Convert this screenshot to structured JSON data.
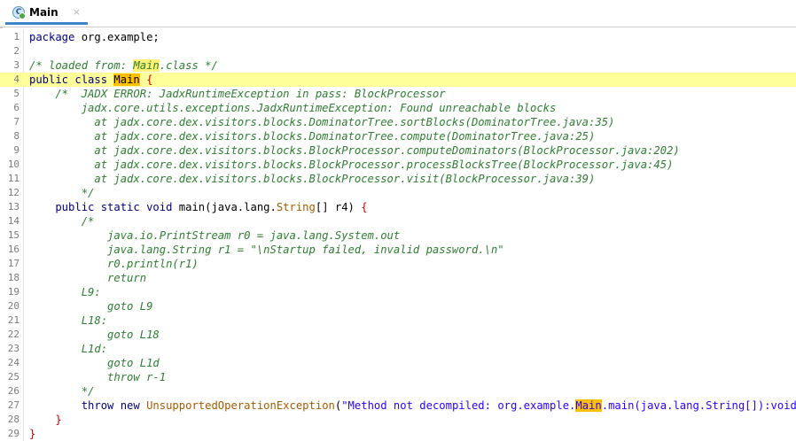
{
  "tab": {
    "label": "Main",
    "icon": "class-file-icon",
    "close_glyph": "×"
  },
  "highlight_color": "#ffff99",
  "lines": [
    {
      "n": "1",
      "t": [
        {
          "k": "kw",
          "v": "package"
        },
        {
          "k": "",
          "v": " org.example;"
        }
      ]
    },
    {
      "n": "2",
      "t": []
    },
    {
      "n": "3",
      "t": [
        {
          "k": "cm",
          "v": "/* loaded from: "
        },
        {
          "k": "cm mark soft",
          "v": "Main"
        },
        {
          "k": "cm",
          "v": ".class */"
        }
      ]
    },
    {
      "n": "4",
      "hl": true,
      "t": [
        {
          "k": "kw",
          "v": "public class "
        },
        {
          "k": "mark",
          "v": "Main"
        },
        {
          "k": "red",
          "v": " {"
        }
      ]
    },
    {
      "n": "5",
      "t": [
        {
          "k": "cm",
          "v": "    /*  JADX ERROR: JadxRuntimeException in pass: BlockProcessor"
        }
      ]
    },
    {
      "n": "6",
      "t": [
        {
          "k": "cm",
          "v": "        jadx.core.utils.exceptions.JadxRuntimeException: Found unreachable blocks"
        }
      ]
    },
    {
      "n": "7",
      "t": [
        {
          "k": "cm",
          "v": "          at jadx.core.dex.visitors.blocks.DominatorTree.sortBlocks(DominatorTree.java:35)"
        }
      ]
    },
    {
      "n": "8",
      "t": [
        {
          "k": "cm",
          "v": "          at jadx.core.dex.visitors.blocks.DominatorTree.compute(DominatorTree.java:25)"
        }
      ]
    },
    {
      "n": "9",
      "t": [
        {
          "k": "cm",
          "v": "          at jadx.core.dex.visitors.blocks.BlockProcessor.computeDominators(BlockProcessor.java:202)"
        }
      ]
    },
    {
      "n": "10",
      "t": [
        {
          "k": "cm",
          "v": "          at jadx.core.dex.visitors.blocks.BlockProcessor.processBlocksTree(BlockProcessor.java:45)"
        }
      ]
    },
    {
      "n": "11",
      "t": [
        {
          "k": "cm",
          "v": "          at jadx.core.dex.visitors.blocks.BlockProcessor.visit(BlockProcessor.java:39)"
        }
      ]
    },
    {
      "n": "12",
      "t": [
        {
          "k": "cm",
          "v": "        */"
        }
      ]
    },
    {
      "n": "13",
      "t": [
        {
          "k": "kw",
          "v": "    public static void "
        },
        {
          "k": "",
          "v": "main(java.lang."
        },
        {
          "k": "ty",
          "v": "String"
        },
        {
          "k": "",
          "v": "[] r4) "
        },
        {
          "k": "red",
          "v": "{"
        }
      ]
    },
    {
      "n": "14",
      "t": [
        {
          "k": "cm",
          "v": "        /*"
        }
      ]
    },
    {
      "n": "15",
      "t": [
        {
          "k": "cm",
          "v": "            java.io.PrintStream r0 = java.lang.System.out"
        }
      ]
    },
    {
      "n": "16",
      "t": [
        {
          "k": "cm",
          "v": "            java.lang.String r1 = \"\\nStartup failed, invalid password.\\n\""
        }
      ]
    },
    {
      "n": "17",
      "t": [
        {
          "k": "cm",
          "v": "            r0.println(r1)"
        }
      ]
    },
    {
      "n": "18",
      "t": [
        {
          "k": "cm",
          "v": "            return"
        }
      ]
    },
    {
      "n": "19",
      "t": [
        {
          "k": "cm",
          "v": "        L9:"
        }
      ]
    },
    {
      "n": "20",
      "t": [
        {
          "k": "cm",
          "v": "            goto L9"
        }
      ]
    },
    {
      "n": "21",
      "t": [
        {
          "k": "cm",
          "v": "        L18:"
        }
      ]
    },
    {
      "n": "22",
      "t": [
        {
          "k": "cm",
          "v": "            goto L18"
        }
      ]
    },
    {
      "n": "23",
      "t": [
        {
          "k": "cm",
          "v": "        L1d:"
        }
      ]
    },
    {
      "n": "24",
      "t": [
        {
          "k": "cm",
          "v": "            goto L1d"
        }
      ]
    },
    {
      "n": "25",
      "t": [
        {
          "k": "cm",
          "v": "            throw r-1"
        }
      ]
    },
    {
      "n": "26",
      "t": [
        {
          "k": "cm",
          "v": "        */"
        }
      ]
    },
    {
      "n": "27",
      "t": [
        {
          "k": "kw",
          "v": "        throw new "
        },
        {
          "k": "ty",
          "v": "UnsupportedOperationException"
        },
        {
          "k": "",
          "v": "("
        },
        {
          "k": "st",
          "v": "\"Method not decompiled: org.example."
        },
        {
          "k": "st mark",
          "v": "Main"
        },
        {
          "k": "st",
          "v": ".main(java.lang.String[]):void\""
        },
        {
          "k": "",
          "v": ");"
        }
      ]
    },
    {
      "n": "28",
      "t": [
        {
          "k": "red",
          "v": "    }"
        }
      ]
    },
    {
      "n": "29",
      "t": [
        {
          "k": "red",
          "v": "}"
        }
      ]
    }
  ]
}
